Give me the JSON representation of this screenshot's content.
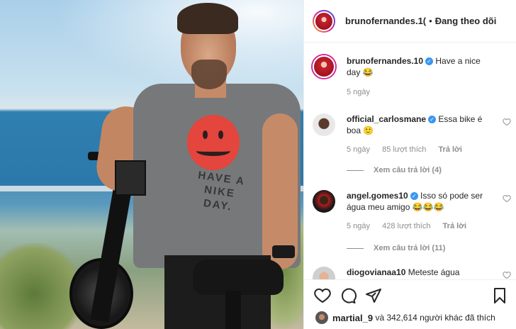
{
  "post": {
    "author": "brunofernandes.10",
    "header_author": "brunofernandes.1(",
    "follow_status": "Đang theo dõi",
    "dot": "•",
    "verified_symbol": "✓"
  },
  "photo": {
    "shirt_text": "HAVE A NIKE DAY."
  },
  "comments": [
    {
      "username": "brunofernandes.10",
      "verified": true,
      "text": "Have a nice day 😂",
      "time": "5 ngày"
    },
    {
      "username": "official_carlosmane",
      "verified": true,
      "text": "Essa bike é boa 🙂",
      "time": "5 ngày",
      "likes": "85 lượt thích",
      "reply_label": "Trả lời",
      "view_replies": "Xem câu trả lời (4)"
    },
    {
      "username": "angel.gomes10",
      "verified": true,
      "text": "Isso só pode ser água meu amigo 😂😂😂",
      "time": "5 ngày",
      "likes": "428 lượt thích",
      "reply_label": "Trả lời",
      "view_replies": "Xem câu trả lời (11)"
    },
    {
      "username": "diogovianaa10",
      "verified": false,
      "text": "Meteste água"
    }
  ],
  "actions": {
    "like_icon": "heart-outline-icon",
    "comment_icon": "comment-bubble-icon",
    "share_icon": "paper-plane-icon",
    "save_icon": "bookmark-icon"
  },
  "likes_summary": {
    "user": "martial_9",
    "rest": "và 342,614 người khác đã thích"
  },
  "colors": {
    "verified_blue": "#3897f0",
    "muted_text": "#8e8e8e",
    "divider": "#efefef"
  }
}
